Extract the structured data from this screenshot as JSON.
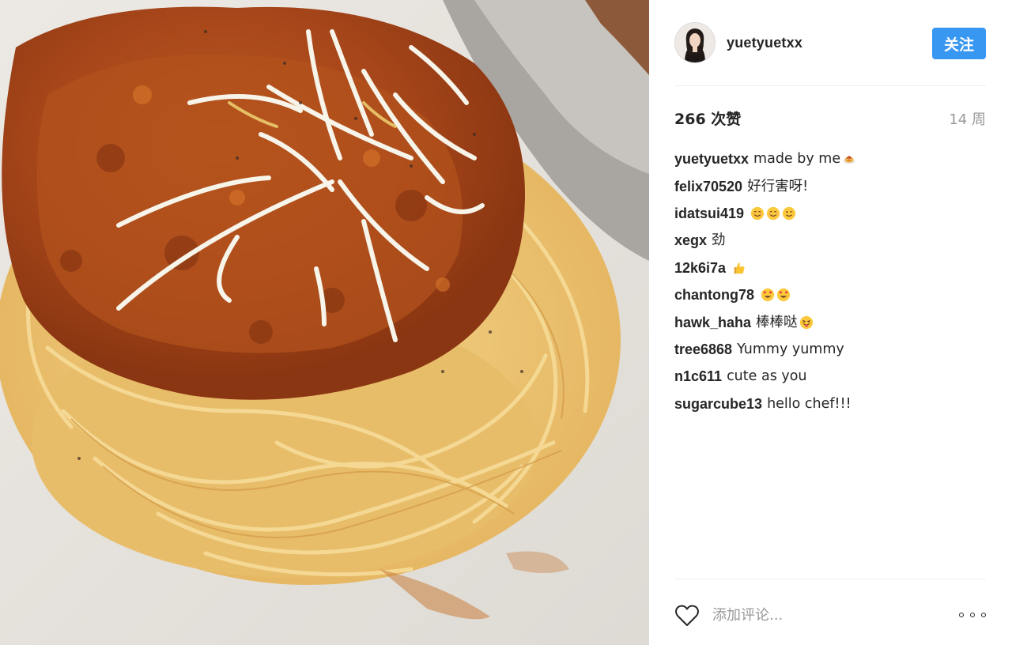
{
  "post": {
    "photo_description_icon": "spaghetti-photo",
    "author": {
      "username": "yuetyuetxx",
      "avatar_icon": "profile-avatar"
    },
    "follow_label": "关注",
    "likes_text": "266 次赞",
    "time_text": "14 周",
    "comments": [
      {
        "user": "yuetyuetxx",
        "text": "made by me",
        "emoji": [
          "spaghetti"
        ]
      },
      {
        "user": "felix70520",
        "text": "好行害呀!",
        "emoji": []
      },
      {
        "user": "idatsui419",
        "text": "",
        "emoji": [
          "smiling-face",
          "smiling-face",
          "winking-face"
        ]
      },
      {
        "user": "xegx",
        "text": "劲",
        "emoji": []
      },
      {
        "user": "12k6i7a",
        "text": "",
        "emoji": [
          "thumbs-up"
        ]
      },
      {
        "user": "chantong78",
        "text": "",
        "emoji": [
          "heart-eyes",
          "heart-eyes"
        ]
      },
      {
        "user": "hawk_haha",
        "text": "棒棒哒",
        "emoji": [
          "tongue-face"
        ]
      },
      {
        "user": "tree6868",
        "text": "Yummy yummy",
        "emoji": []
      },
      {
        "user": "n1c611",
        "text": "cute as you",
        "emoji": []
      },
      {
        "user": "sugarcube13",
        "text": "hello chef!!!",
        "emoji": []
      }
    ],
    "comment_placeholder": "添加评论...",
    "like_icon": "heart-outline-icon",
    "more_icon": "more-options-icon"
  },
  "colors": {
    "accent": "#3897f0",
    "text": "#262626",
    "muted": "#999999",
    "divider": "#efefef"
  }
}
